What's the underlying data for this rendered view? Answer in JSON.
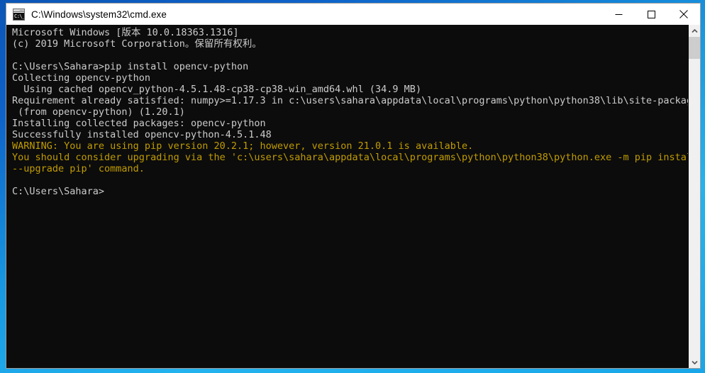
{
  "window": {
    "title": "C:\\Windows\\system32\\cmd.exe",
    "icon": "cmd-icon",
    "icon_glyph": "C:\\_",
    "border_color": "#1898e0",
    "controls": {
      "minimize": "minimize-button",
      "maximize": "maximize-button",
      "close": "close-button"
    }
  },
  "terminal": {
    "background": "#0c0c0c",
    "foreground": "#cccccc",
    "warning_color": "#c19c00",
    "lines": [
      {
        "text": "Microsoft Windows [版本 10.0.18363.1316]",
        "style": "normal"
      },
      {
        "text": "(c) 2019 Microsoft Corporation。保留所有权利。",
        "style": "normal"
      },
      {
        "text": "",
        "style": "normal"
      },
      {
        "text": "C:\\Users\\Sahara>pip install opencv-python",
        "style": "normal"
      },
      {
        "text": "Collecting opencv-python",
        "style": "normal"
      },
      {
        "text": "  Using cached opencv_python-4.5.1.48-cp38-cp38-win_amd64.whl (34.9 MB)",
        "style": "normal"
      },
      {
        "text": "Requirement already satisfied: numpy>=1.17.3 in c:\\users\\sahara\\appdata\\local\\programs\\python\\python38\\lib\\site-packages",
        "style": "normal"
      },
      {
        "text": " (from opencv-python) (1.20.1)",
        "style": "normal"
      },
      {
        "text": "Installing collected packages: opencv-python",
        "style": "normal"
      },
      {
        "text": "Successfully installed opencv-python-4.5.1.48",
        "style": "normal"
      },
      {
        "text": "WARNING: You are using pip version 20.2.1; however, version 21.0.1 is available.",
        "style": "warning"
      },
      {
        "text": "You should consider upgrading via the 'c:\\users\\sahara\\appdata\\local\\programs\\python\\python38\\python.exe -m pip install",
        "style": "warning"
      },
      {
        "text": "--upgrade pip' command.",
        "style": "warning"
      },
      {
        "text": "",
        "style": "normal"
      },
      {
        "text": "C:\\Users\\Sahara>",
        "style": "normal"
      }
    ]
  },
  "scrollbar": {
    "up_arrow": "scroll-up-arrow",
    "down_arrow": "scroll-down-arrow",
    "thumb": "scrollbar-thumb"
  }
}
